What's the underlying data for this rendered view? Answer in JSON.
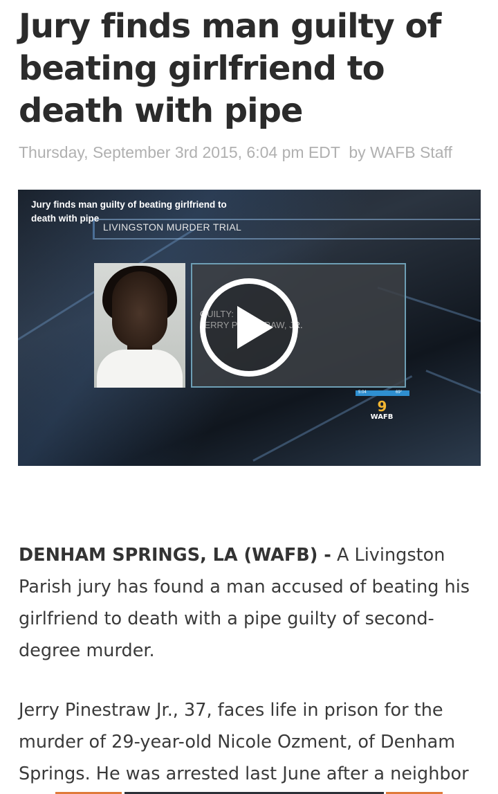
{
  "article": {
    "headline": "Jury finds man guilty of beating girlfriend to death with pipe",
    "date": "Thursday, September 3rd 2015, 6:04 pm EDT",
    "author": "by WAFB Staff"
  },
  "video": {
    "title": "Jury finds man guilty of beating girlfriend to death with pipe",
    "banner": "LIVINGSTON MURDER TRIAL",
    "caption_line1": "GUILTY:",
    "caption_line2": "JERRY PINESTRAW, JR.",
    "time": "5:04",
    "temp": "69°",
    "station_number": "9",
    "station_call": "WAFB",
    "play_icon": "play-icon"
  },
  "body": {
    "dateline": "DENHAM SPRINGS, LA (WAFB) -",
    "p1_text": " A Livingston Parish jury has found a man accused of beating his girlfriend to death with a pipe guilty of second-degree murder.",
    "p2_text": "Jerry Pinestraw Jr., 37, faces life in prison for the murder of 29-year-old Nicole Ozment, of Denham Springs. He was arrested last June after a neighbor"
  },
  "colors": {
    "accent_orange": "#e07b39",
    "dark_strip": "#2b2f36"
  }
}
